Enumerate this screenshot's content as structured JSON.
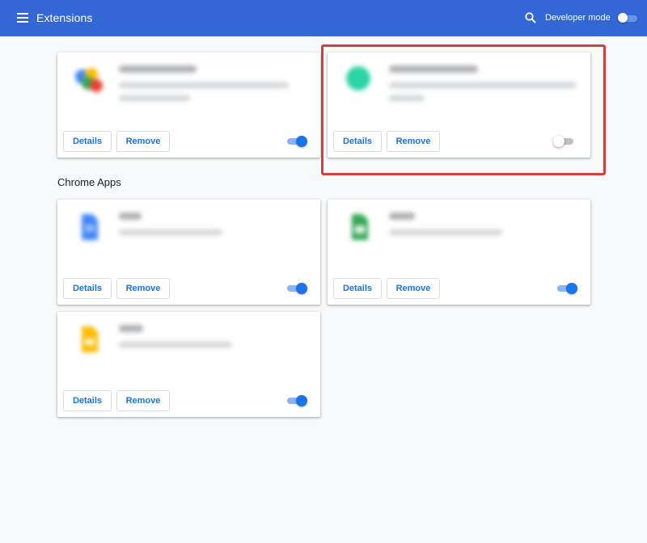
{
  "header": {
    "title": "Extensions",
    "menu_icon": "hamburger-menu-icon",
    "search_icon": "search-icon",
    "developer_mode_label": "Developer mode",
    "developer_mode_on": false
  },
  "colors": {
    "header_bg": "#3367d6",
    "accent": "#1a73e8",
    "highlight": "#d23f3f"
  },
  "extensions": [
    {
      "details_label": "Details",
      "remove_label": "Remove",
      "enabled": true
    },
    {
      "details_label": "Details",
      "remove_label": "Remove",
      "enabled": false
    }
  ],
  "chrome_apps": {
    "heading": "Chrome Apps",
    "items": [
      {
        "details_label": "Details",
        "remove_label": "Remove",
        "enabled": true
      },
      {
        "details_label": "Details",
        "remove_label": "Remove",
        "enabled": true
      },
      {
        "details_label": "Details",
        "remove_label": "Remove",
        "enabled": true
      }
    ]
  }
}
